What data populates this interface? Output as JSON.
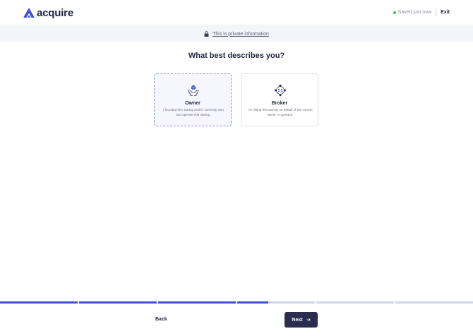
{
  "header": {
    "logo_text": "acquire",
    "saved_status": "Saved just now",
    "exit_label": "Exit"
  },
  "banner": {
    "text": "This is private information"
  },
  "main": {
    "question": "What best describes you?",
    "options": [
      {
        "title": "Owner",
        "description": "I founded this startup and/or currently own and operate this startup.",
        "selected": true,
        "icon": "hands-cube-icon"
      },
      {
        "title": "Broker",
        "description": "I'm listing this startup on behalf of the current owner or operator.",
        "selected": false,
        "icon": "network-people-icon"
      }
    ]
  },
  "progress": {
    "segments": [
      1,
      1,
      1,
      0.4,
      0,
      0
    ],
    "color_filled": "#3f51d8",
    "color_empty": "#cdd6ec"
  },
  "footer": {
    "back_label": "Back",
    "next_label": "Next"
  },
  "colors": {
    "brand": "#3f51d8",
    "dark": "#2b2d4f",
    "success": "#3cc35a"
  }
}
